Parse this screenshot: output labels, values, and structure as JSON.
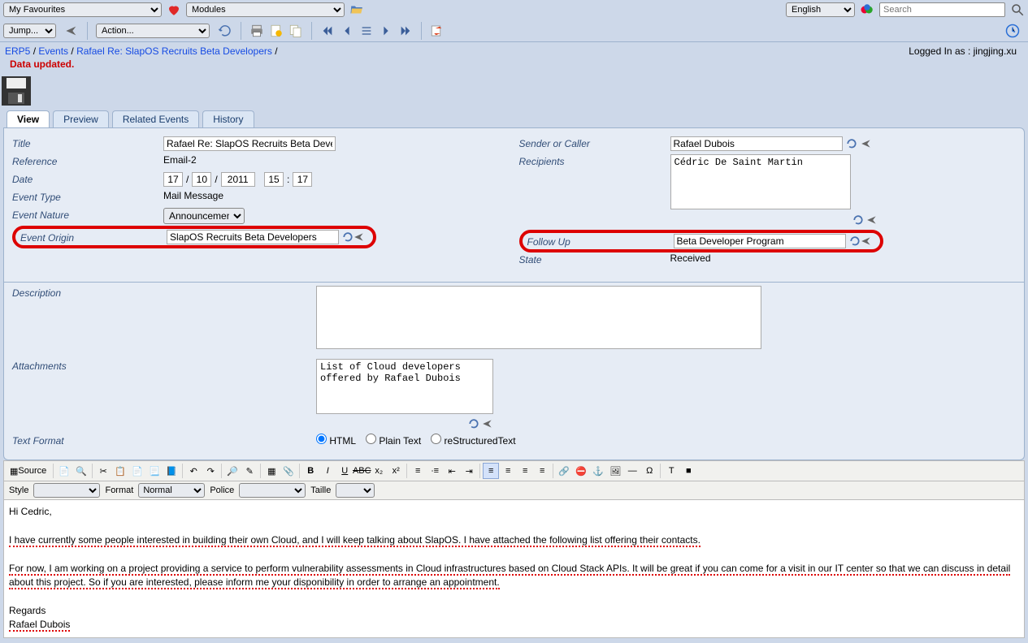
{
  "topbar": {
    "favorites": "My Favourites",
    "modules": "Modules",
    "language": "English",
    "search_placeholder": "Search"
  },
  "toolbar2": {
    "jump": "Jump...",
    "action": "Action..."
  },
  "breadcrumb": {
    "seg1": "ERP5",
    "seg2": "Events",
    "seg3": "Rafael Re: SlapOS Recruits Beta Developers",
    "sep": " / "
  },
  "status": "Data updated.",
  "login_prefix": "Logged In as : ",
  "login_user": "jingjing.xu",
  "tabs": {
    "view": "View",
    "preview": "Preview",
    "related": "Related Events",
    "history": "History"
  },
  "form": {
    "labels": {
      "title": "Title",
      "reference": "Reference",
      "date": "Date",
      "event_type": "Event Type",
      "event_nature": "Event Nature",
      "event_origin": "Event Origin",
      "sender": "Sender or Caller",
      "recipients": "Recipients",
      "follow_up": "Follow Up",
      "state": "State",
      "description": "Description",
      "attachments": "Attachments",
      "text_format": "Text Format"
    },
    "title": "Rafael Re: SlapOS Recruits Beta Developers",
    "reference": "Email-2",
    "date": {
      "d": "17",
      "m": "10",
      "y": "2011",
      "h": "15",
      "min": "17"
    },
    "event_type": "Mail Message",
    "event_nature": "Announcement",
    "event_origin": "SlapOS Recruits Beta Developers",
    "sender": "Rafael Dubois",
    "recipients": "Cédric De Saint Martin",
    "follow_up": "Beta Developer Program",
    "state": "Received",
    "description": "",
    "attachments": "List of Cloud developers offered by Rafael Dubois",
    "text_format": {
      "html": "HTML",
      "plain": "Plain Text",
      "rst": "reStructuredText"
    }
  },
  "ckeditor": {
    "source": "Source",
    "style": "Style",
    "format": "Format",
    "format_val": "Normal",
    "police": "Police",
    "taille": "Taille"
  },
  "body": {
    "l1": "Hi Cedric,",
    "l2a": "I have currently some people interested in building their own Cloud, and I will keep talking about SlapOS. I have attached the following list offering their contacts.",
    "l3": "For now, I am working on a project providing a service to perform vulnerability assessments in Cloud infrastructures based on Cloud Stack APIs. It will be great if you can come for a visit in our IT center so that we can discuss in detail about this project. So if you are interested, please inform me your disponibility in order to arrange an appointment.",
    "l4": "Regards",
    "l5": "Rafael Dubois"
  }
}
